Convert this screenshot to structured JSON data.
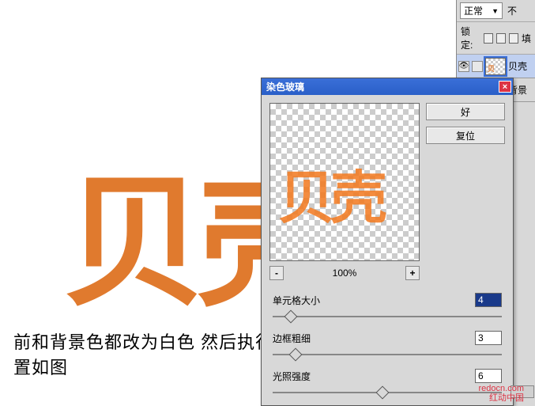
{
  "canvas": {
    "main_text": "贝壳",
    "instruction": "前和背景色都改为白色  然后执行滤镜  纹理  染色玻璃  设置如图"
  },
  "layers_panel": {
    "blend_mode": "正常",
    "opacity_label": "不",
    "lock_label": "锁定:",
    "lock_fill_label": "填",
    "layers": [
      {
        "name": "贝壳",
        "visible": true,
        "selected": true
      },
      {
        "name": "背景",
        "visible": true,
        "selected": false
      }
    ]
  },
  "filter_dialog": {
    "title": "染色玻璃",
    "ok_label": "好",
    "reset_label": "复位",
    "zoom_minus": "-",
    "zoom_plus": "+",
    "zoom_value": "100%",
    "preview_text": "贝壳",
    "params": [
      {
        "label": "单元格大小",
        "value": "4",
        "pos": 8,
        "selected": true
      },
      {
        "label": "边框粗细",
        "value": "3",
        "pos": 10
      },
      {
        "label": "光照强度",
        "value": "6",
        "pos": 48
      }
    ]
  },
  "watermark": {
    "line1": "redocn.com",
    "line2": "红动中国"
  }
}
